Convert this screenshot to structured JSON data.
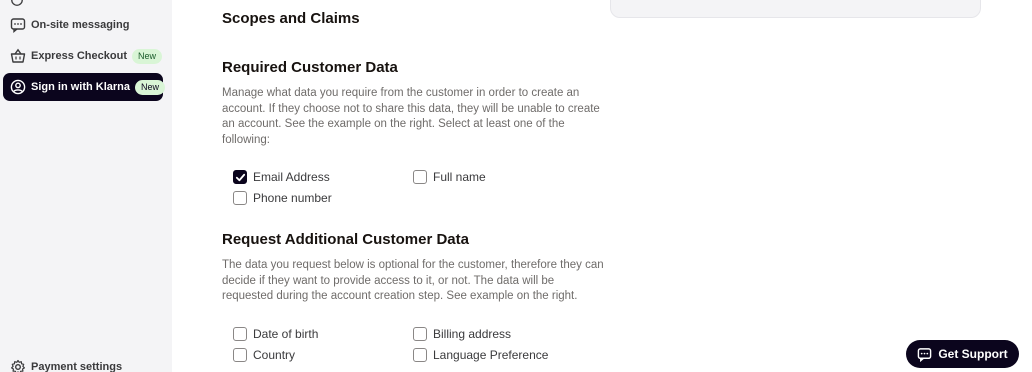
{
  "sidebar": {
    "items": [
      {
        "label": "On-site messaging",
        "icon": "chat-dots-icon"
      },
      {
        "label": "Express Checkout",
        "icon": "basket-icon",
        "badge": "New"
      },
      {
        "label": "Sign in with Klarna",
        "icon": "user-circle-icon",
        "badge": "New",
        "active": true
      },
      {
        "label": "Payment settings",
        "icon": "gear-icon"
      }
    ]
  },
  "main": {
    "scopes_title": "Scopes and Claims",
    "required": {
      "title": "Required Customer Data",
      "description": "Manage what data you require from the customer in order to create an account. If they choose not to share this data, they will be unable to create an account. See the example on the right. Select at least one of the following:",
      "options": [
        {
          "label": "Email Address",
          "checked": true
        },
        {
          "label": "Full name",
          "checked": false
        },
        {
          "label": "Phone number",
          "checked": false
        }
      ]
    },
    "additional": {
      "title": "Request Additional Customer Data",
      "description": "The data you request below is optional for the customer, therefore they can decide if they want to provide access to it, or not. The data will be requested during the account creation step. See example on the right.",
      "options": [
        {
          "label": "Date of birth",
          "checked": false
        },
        {
          "label": "Billing address",
          "checked": false
        },
        {
          "label": "Country",
          "checked": false
        },
        {
          "label": "Language Preference",
          "checked": false
        }
      ]
    }
  },
  "support": {
    "label": "Get Support",
    "icon": "chat-bubble-icon"
  },
  "colors": {
    "accent": "#0b051d",
    "badge_bg": "#d9f5d6",
    "sidebar_bg": "#f4f4f6",
    "muted_text": "#6f6c6a"
  }
}
